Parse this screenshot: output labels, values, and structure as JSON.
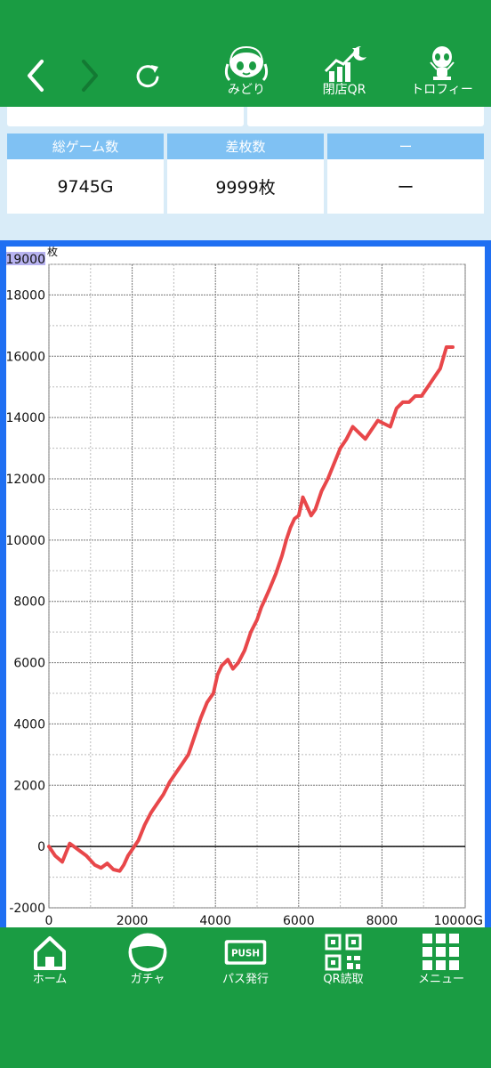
{
  "top_nav": {
    "items": [
      {
        "label": "みどり",
        "icon": "character-face-icon"
      },
      {
        "label": "閉店QR",
        "icon": "growth-chart-moon-icon"
      },
      {
        "label": "トロフィー",
        "icon": "alien-trophy-icon"
      }
    ]
  },
  "stats": {
    "cards": [
      {
        "header": "総ゲーム数",
        "value": "9745G"
      },
      {
        "header": "差枚数",
        "value": "9999枚"
      },
      {
        "header": "ー",
        "value": "ー"
      }
    ]
  },
  "chart_data": {
    "type": "line",
    "unit_label": "枚",
    "top_label": "19000",
    "x_end_label": "10000G",
    "xlim": [
      0,
      10000
    ],
    "ylim": [
      -2000,
      19000
    ],
    "x_ticks": [
      0,
      2000,
      4000,
      6000,
      8000
    ],
    "y_ticks": [
      -2000,
      0,
      2000,
      4000,
      6000,
      8000,
      10000,
      12000,
      14000,
      16000,
      18000
    ],
    "line_color": "#e8474a",
    "series": [
      {
        "x": [
          0,
          150,
          320,
          500,
          700,
          900,
          1100,
          1250,
          1400,
          1550,
          1700,
          1800,
          1900,
          2000,
          2150,
          2300,
          2450,
          2600,
          2750,
          2900,
          3050,
          3200,
          3350,
          3500,
          3650,
          3800,
          3950,
          4050,
          4150,
          4300,
          4420,
          4550,
          4700,
          4850,
          5000,
          5100,
          5200,
          5300,
          5450,
          5600,
          5700,
          5800,
          5900,
          6000,
          6100,
          6200,
          6300,
          6400,
          6550,
          6700,
          6850,
          7000,
          7150,
          7300,
          7450,
          7600,
          7750,
          7900,
          8050,
          8200,
          8350,
          8500,
          8650,
          8800,
          8950,
          9100,
          9250,
          9400,
          9550,
          9700
        ],
        "y": [
          0,
          -300,
          -500,
          100,
          -100,
          -300,
          -600,
          -700,
          -550,
          -750,
          -800,
          -600,
          -300,
          -100,
          200,
          700,
          1100,
          1400,
          1700,
          2100,
          2400,
          2700,
          3000,
          3600,
          4200,
          4700,
          5000,
          5600,
          5900,
          6100,
          5800,
          6000,
          6400,
          7000,
          7400,
          7800,
          8100,
          8400,
          8900,
          9500,
          10000,
          10400,
          10700,
          10800,
          11400,
          11100,
          10800,
          11000,
          11600,
          12000,
          12500,
          13000,
          13300,
          13700,
          13500,
          13300,
          13600,
          13900,
          13800,
          13700,
          14300,
          14500,
          14500,
          14700,
          14700,
          15000,
          15300,
          15600,
          16300,
          16300
        ]
      }
    ]
  },
  "bottom_nav": {
    "items": [
      {
        "label": "ホーム",
        "icon": "home-icon"
      },
      {
        "label": "ガチャ",
        "icon": "gacha-ball-icon"
      },
      {
        "label": "パス発行",
        "icon": "push-pass-icon"
      },
      {
        "label": "QR読取",
        "icon": "qr-code-icon"
      },
      {
        "label": "メニュー",
        "icon": "menu-grid-icon"
      }
    ],
    "push_text": "PUSH"
  }
}
